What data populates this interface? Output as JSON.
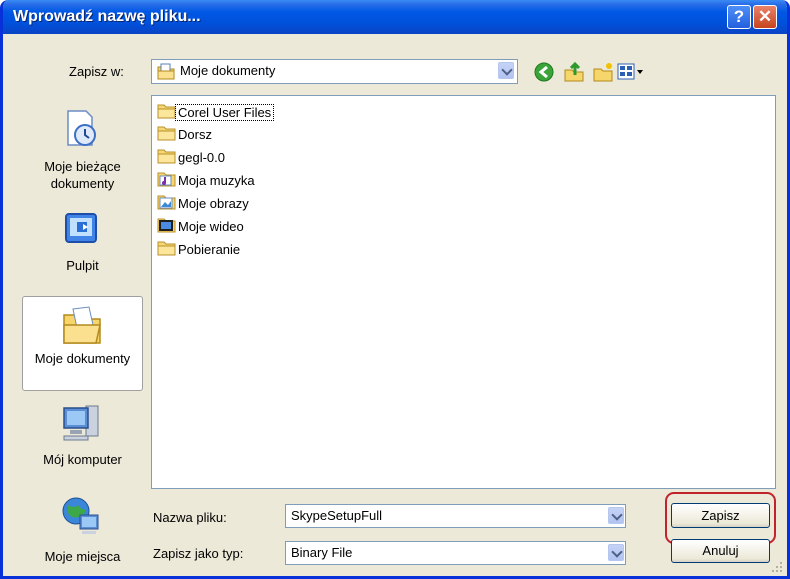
{
  "window": {
    "title": "Wprowadź nazwę pliku...",
    "help_glyph": "?",
    "close_glyph": "✕"
  },
  "toolbar": {
    "save_in_label": "Zapisz w:",
    "location": "Moje dokumenty"
  },
  "places": [
    {
      "label": "Moje bieżące dokumenty",
      "icon": "recent-documents-icon"
    },
    {
      "label": "Pulpit",
      "icon": "desktop-icon"
    },
    {
      "label": "Moje dokumenty",
      "icon": "my-documents-icon",
      "selected": true
    },
    {
      "label": "Mój komputer",
      "icon": "my-computer-icon"
    },
    {
      "label": "Moje miejsca",
      "icon": "network-places-icon"
    }
  ],
  "files": [
    {
      "name": "Corel User Files",
      "icon": "folder-icon"
    },
    {
      "name": "Dorsz",
      "icon": "folder-icon"
    },
    {
      "name": "gegl-0.0",
      "icon": "folder-icon"
    },
    {
      "name": "Moja muzyka",
      "icon": "music-folder-icon"
    },
    {
      "name": "Moje obrazy",
      "icon": "pictures-folder-icon"
    },
    {
      "name": "Moje wideo",
      "icon": "video-folder-icon"
    },
    {
      "name": "Pobieranie",
      "icon": "folder-icon"
    }
  ],
  "form": {
    "filename_label": "Nazwa pliku:",
    "filename_value": "SkypeSetupFull",
    "filetype_label": "Zapisz jako typ:",
    "filetype_value": "Binary File"
  },
  "buttons": {
    "save": "Zapisz",
    "cancel": "Anuluj"
  },
  "colors": {
    "titlebar": "#0058e6",
    "highlight": "#c0232c"
  }
}
